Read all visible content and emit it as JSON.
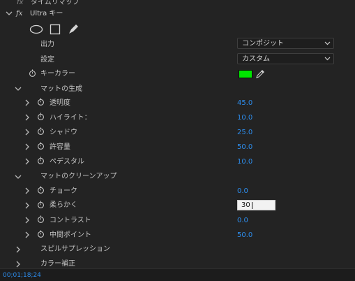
{
  "header": {
    "time_remap_label": "タイムリマップ",
    "effect_fx": "fx",
    "effect_name": "Ultra キー"
  },
  "mask_tools": [
    "ellipse-mask-icon",
    "rectangle-mask-icon",
    "pen-mask-icon"
  ],
  "output": {
    "label": "出力",
    "value": "コンポジット"
  },
  "setting": {
    "label": "設定",
    "value": "カスタム"
  },
  "key_color": {
    "label": "キーカラー",
    "swatch": "#00e600"
  },
  "matte_generation": {
    "label": "マットの生成",
    "params": [
      {
        "label": "透明度",
        "value": "45.0"
      },
      {
        "label": "ハイライト：",
        "value": "10.0"
      },
      {
        "label": "シャドウ",
        "value": "25.0"
      },
      {
        "label": "許容量",
        "value": "50.0"
      },
      {
        "label": "ペデスタル",
        "value": "10.0"
      }
    ]
  },
  "matte_cleanup": {
    "label": "マットのクリーンアップ",
    "params": [
      {
        "label": "チョーク",
        "value": "0.0"
      },
      {
        "label": "柔らかく",
        "value": "30"
      },
      {
        "label": "コントラスト",
        "value": "0.0"
      },
      {
        "label": "中間ポイント",
        "value": "50.0"
      }
    ]
  },
  "spill_suppression": {
    "label": "スピルサプレッション"
  },
  "color_correction": {
    "label": "カラー補正"
  },
  "status": {
    "timecode": "00;01;18;24"
  },
  "colors": {
    "accent": "#2d8ceb",
    "background": "#232323",
    "key": "#00e600"
  }
}
